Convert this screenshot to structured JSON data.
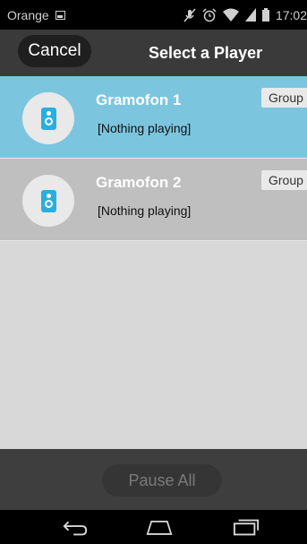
{
  "status_bar": {
    "carrier": "Orange",
    "time": "17:02"
  },
  "header": {
    "cancel_label": "Cancel",
    "title": "Select a Player"
  },
  "players": [
    {
      "name": "Gramofon 1",
      "status": "[Nothing playing]",
      "group_label": "Group",
      "selected": true
    },
    {
      "name": "Gramofon 2",
      "status": "[Nothing playing]",
      "group_label": "Group",
      "selected": false
    }
  ],
  "footer": {
    "pause_all_label": "Pause All"
  },
  "colors": {
    "selected": "#7cc5df",
    "row": "#bfbfbf",
    "speaker": "#29aee0"
  },
  "icons": [
    "gallery-icon",
    "mute-icon",
    "alarm-icon",
    "wifi-icon",
    "signal-icon",
    "battery-icon",
    "speaker-icon",
    "back-icon",
    "home-icon",
    "recent-apps-icon"
  ]
}
